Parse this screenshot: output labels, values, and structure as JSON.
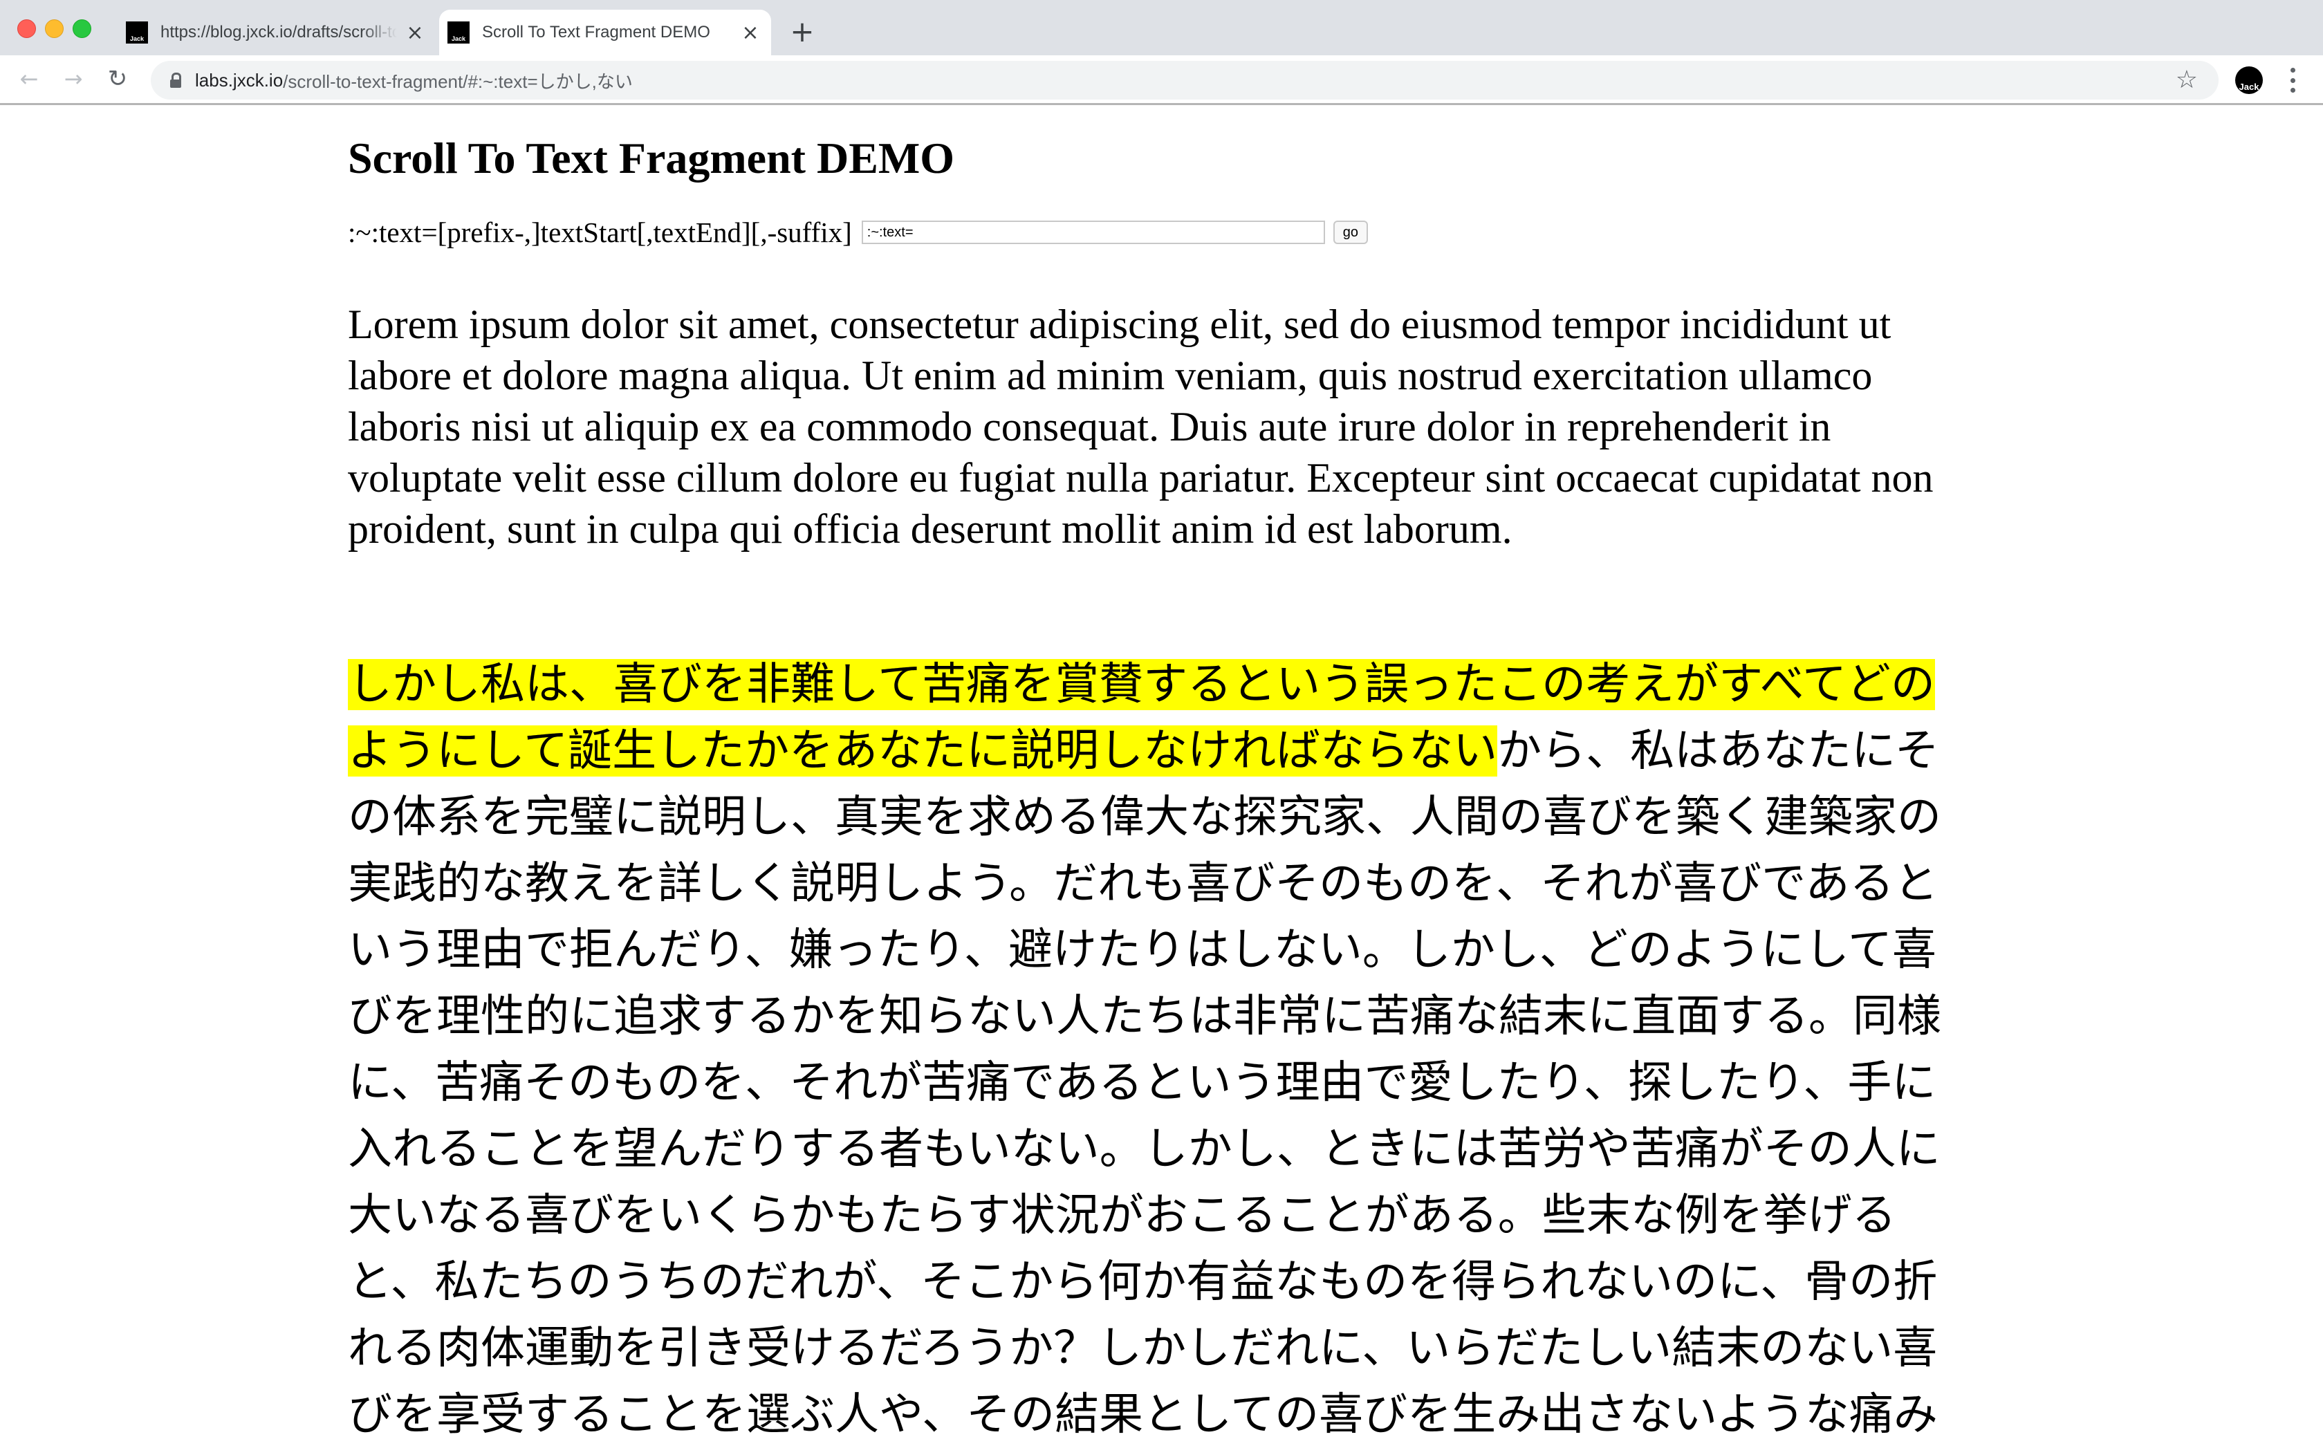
{
  "browser": {
    "tabs": [
      {
        "title": "https://blog.jxck.io/drafts/scroll-to-text-fragment",
        "favicon_label": "Jack",
        "active": false
      },
      {
        "title": "Scroll To Text Fragment DEMO",
        "favicon_label": "Jack",
        "active": true
      }
    ],
    "new_tab_icon": "+",
    "close_icon": "×",
    "nav": {
      "back_icon": "←",
      "forward_icon": "→",
      "reload_icon": "↻"
    },
    "address": {
      "host": "labs.jxck.io",
      "path": "/scroll-to-text-fragment/#:~:text=しかし,ない"
    },
    "bookmark_icon": "☆",
    "profile_label": "Jack"
  },
  "page": {
    "title": "Scroll To Text Fragment DEMO",
    "syntax_label": ":~:text=[prefix-,]textStart[,textEnd][,-suffix]",
    "fragment_input_value": ":~:text=",
    "go_label": "go",
    "lorem": "Lorem ipsum dolor sit amet, consectetur adipiscing elit, sed do eiusmod tempor incididunt ut labore et dolore magna aliqua. Ut enim ad minim veniam, quis nostrud exercitation ullamco laboris nisi ut aliquip ex ea commodo consequat. Duis aute irure dolor in reprehenderit in voluptate velit esse cillum dolore eu fugiat nulla pariatur. Excepteur sint occaecat cupidatat non proident, sunt in culpa qui officia deserunt mollit anim id est laborum.",
    "japanese_highlighted": "しかし私は、喜びを非難して苦痛を賞賛するという誤ったこの考えがすべてどのようにして誕生したかをあなたに説明しなければならない",
    "japanese_rest": "から、私はあなたにその体系を完璧に説明し、真実を求める偉大な探究家、人間の喜びを築く建築家の実践的な教えを詳しく説明しよう。だれも喜びそのものを、それが喜びであるという理由で拒んだり、嫌ったり、避けたりはしない。しかし、どのようにして喜びを理性的に追求するかを知らない人たちは非常に苦痛な結末に直面する。同様に、苦痛そのものを、それが苦痛であるという理由で愛したり、探したり、手に入れることを望んだりする者もいない。しかし、ときには苦労や苦痛がその人に大いなる喜びをいくらかもたらす状況がおこることがある。些末な例を挙げると、私たちのうちのだれが、そこから何か有益なものを得られないのに、骨の折れる肉体運動を引き受けるだろうか？しかしだれに、いらだたしい結末のない喜びを享受することを選ぶ人や、その結果としての喜びを生み出さないような痛み",
    "highlight_color": "#ffff00"
  }
}
